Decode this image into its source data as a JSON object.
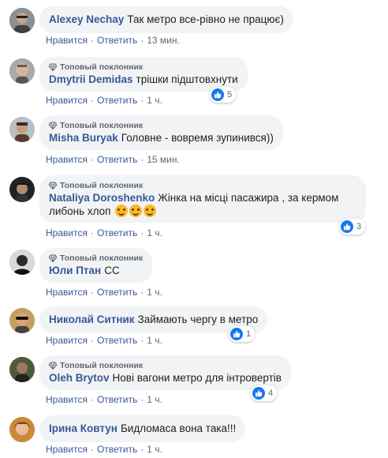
{
  "labels": {
    "like": "Нравится",
    "reply": "Ответить",
    "fan_badge": "Топовый поклонник"
  },
  "comments": [
    {
      "author": "Alexey Nechay",
      "text": "Так метро все-рівно не працює)",
      "time": "13 мин."
    },
    {
      "author": "Dmytrii Demidas",
      "text": "трішки підштовхнути",
      "time": "1 ч.",
      "reactions": "5"
    },
    {
      "author": "Misha Buryak",
      "text": "Головне - вовремя зупинився))",
      "time": "15 мин."
    },
    {
      "author": "Nataliya Doroshenko",
      "text_line1": "Жінка на місці пасажира , за кермом",
      "text_line2": "либонь хлоп",
      "time": "1 ч.",
      "reactions": "3"
    },
    {
      "author": "Юли Птан",
      "text": "СС",
      "time": "1 ч."
    },
    {
      "author": "Николай Ситник",
      "text": "Займають чергу в метро",
      "time": "1 ч.",
      "reactions": "1"
    },
    {
      "author": "Oleh Brytov",
      "text": "Нові вагони метро для інтровертів",
      "time": "1 ч.",
      "reactions": "4"
    },
    {
      "author": "Ірина Ковтун",
      "text": "Бидломаса вона така!!!",
      "time": "1 ч."
    }
  ],
  "colors": {
    "link": "#385898",
    "bubble": "#f2f3f5",
    "like": "#1877f2"
  }
}
